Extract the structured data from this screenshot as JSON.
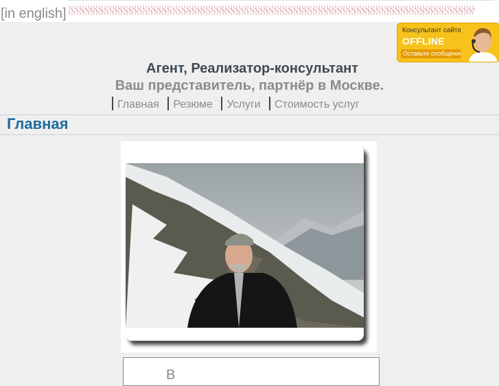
{
  "header": {
    "lang_link": "[in english]"
  },
  "consultant_widget": {
    "line1": "Консультант сайта",
    "status": "OFFLINE",
    "action": "Оставьте сообщение"
  },
  "site": {
    "title": "Агент, Реализатор-консультант",
    "subtitle": "Ваш представитель, партнёр в Москве."
  },
  "nav": {
    "items": [
      {
        "label": "Главная"
      },
      {
        "label": "Резюме"
      },
      {
        "label": "Услуги"
      },
      {
        "label": "Стоимость услуг"
      }
    ]
  },
  "page": {
    "heading": "Главная",
    "box_text": "В"
  },
  "colors": {
    "background": "#efefef",
    "heading": "#1f6a9b",
    "widget": "#f6c21b"
  }
}
